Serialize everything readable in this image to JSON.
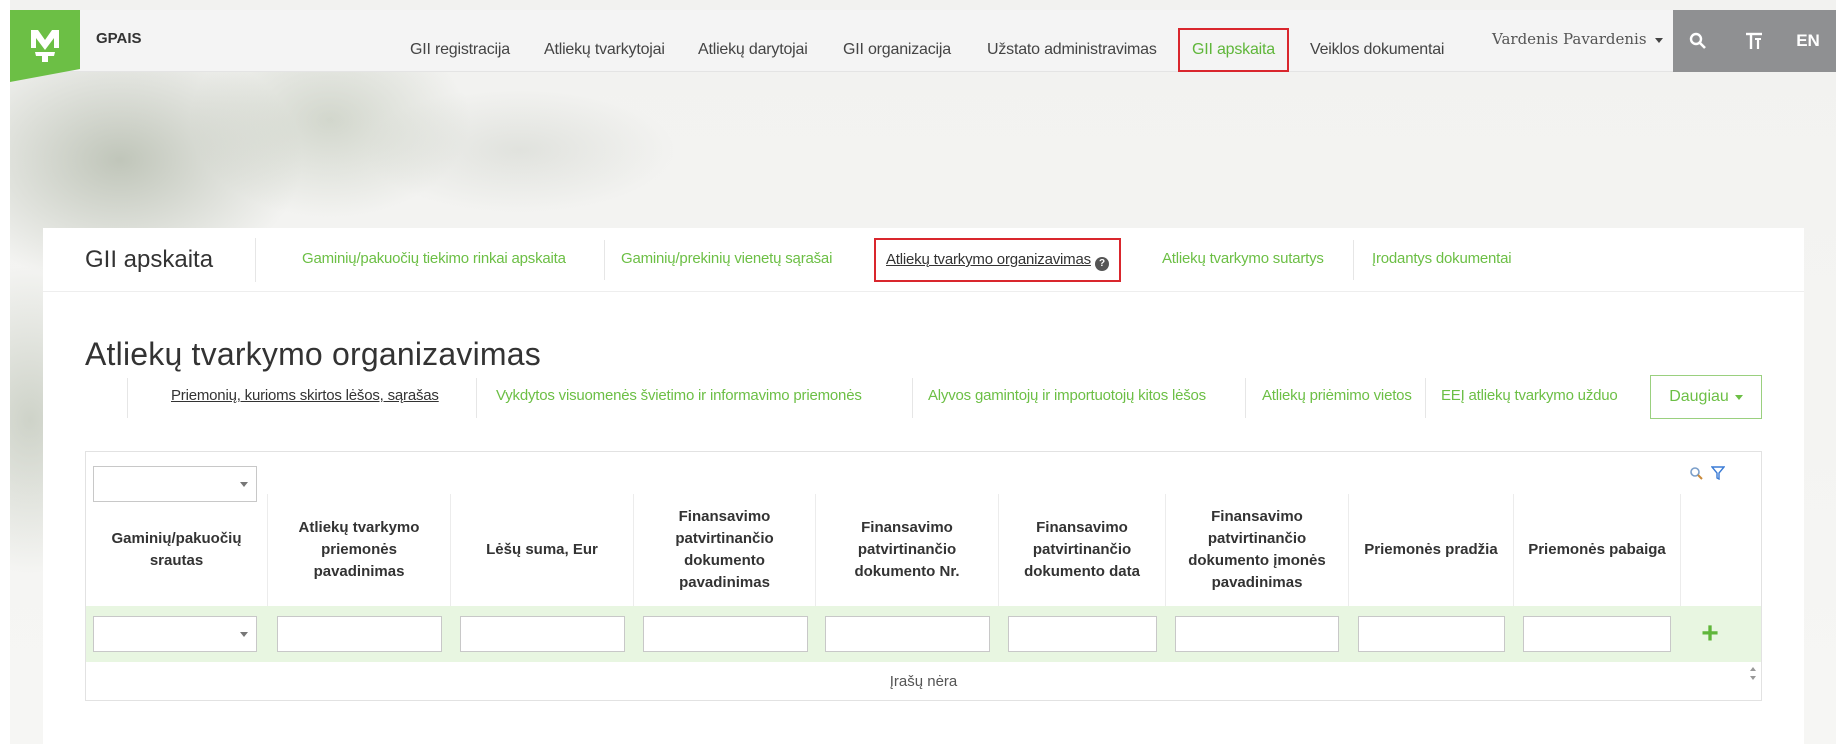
{
  "app": {
    "name": "GPAIS"
  },
  "topnav": {
    "items": [
      {
        "label": "GII registracija",
        "active": false
      },
      {
        "label": "Atliekų tvarkytojai",
        "active": false
      },
      {
        "label": "Atliekų darytojai",
        "active": false
      },
      {
        "label": "GII organizacija",
        "active": false
      },
      {
        "label": "Užstato administravimas",
        "active": false
      },
      {
        "label": "GII apskaita",
        "active": true
      },
      {
        "label": "Veiklos dokumentai",
        "active": false
      }
    ],
    "user": "Vardenis Pavardenis",
    "utilities": [
      "search-icon",
      "font-size-icon",
      "EN"
    ],
    "language": "EN"
  },
  "section": {
    "title": "GII apskaita",
    "subnav": [
      {
        "label": "Gaminių/pakuočių tiekimo rinkai apskaita",
        "active": false
      },
      {
        "label": "Gaminių/prekinių vienetų sąrašai",
        "active": false
      },
      {
        "label": "Atliekų tvarkymo organizavimas",
        "active": true,
        "help": "?"
      },
      {
        "label": "Atliekų tvarkymo sutartys",
        "active": false
      },
      {
        "label": "Įrodantys dokumentai",
        "active": false
      }
    ]
  },
  "page": {
    "title": "Atliekų tvarkymo organizavimas",
    "tabs": [
      {
        "label": "Priemonių, kurioms skirtos lėšos, sąrašas",
        "active": true
      },
      {
        "label": "Vykdytos visuomenės švietimo ir informavimo priemonės",
        "active": false
      },
      {
        "label": "Alyvos gamintojų ir importuotojų kitos lėšos",
        "active": false
      },
      {
        "label": "Atliekų priėmimo vietos",
        "active": false
      },
      {
        "label": "EEĮ atliekų tvarkymo užduo",
        "active": false
      }
    ],
    "more_label": "Daugiau"
  },
  "table": {
    "columns": [
      "Gaminių/pakuočių srautas",
      "Atliekų tvarkymo priemonės pavadinimas",
      "Lėšų suma, Eur",
      "Finansavimo patvirtinančio dokumento pavadinimas",
      "Finansavimo patvirtinančio dokumento Nr.",
      "Finansavimo patvirtinančio dokumento data",
      "Finansavimo patvirtinančio dokumento įmonės pavadinimas",
      "Priemonės pradžia",
      "Priemonės pabaiga"
    ],
    "add_label": "+",
    "empty_text": "Įrašų nėra"
  },
  "colors": {
    "accent": "#6cbf45",
    "highlight_border": "#d9262d",
    "filter_row": "#e8f6e1",
    "utility_bar": "#8f9092"
  }
}
